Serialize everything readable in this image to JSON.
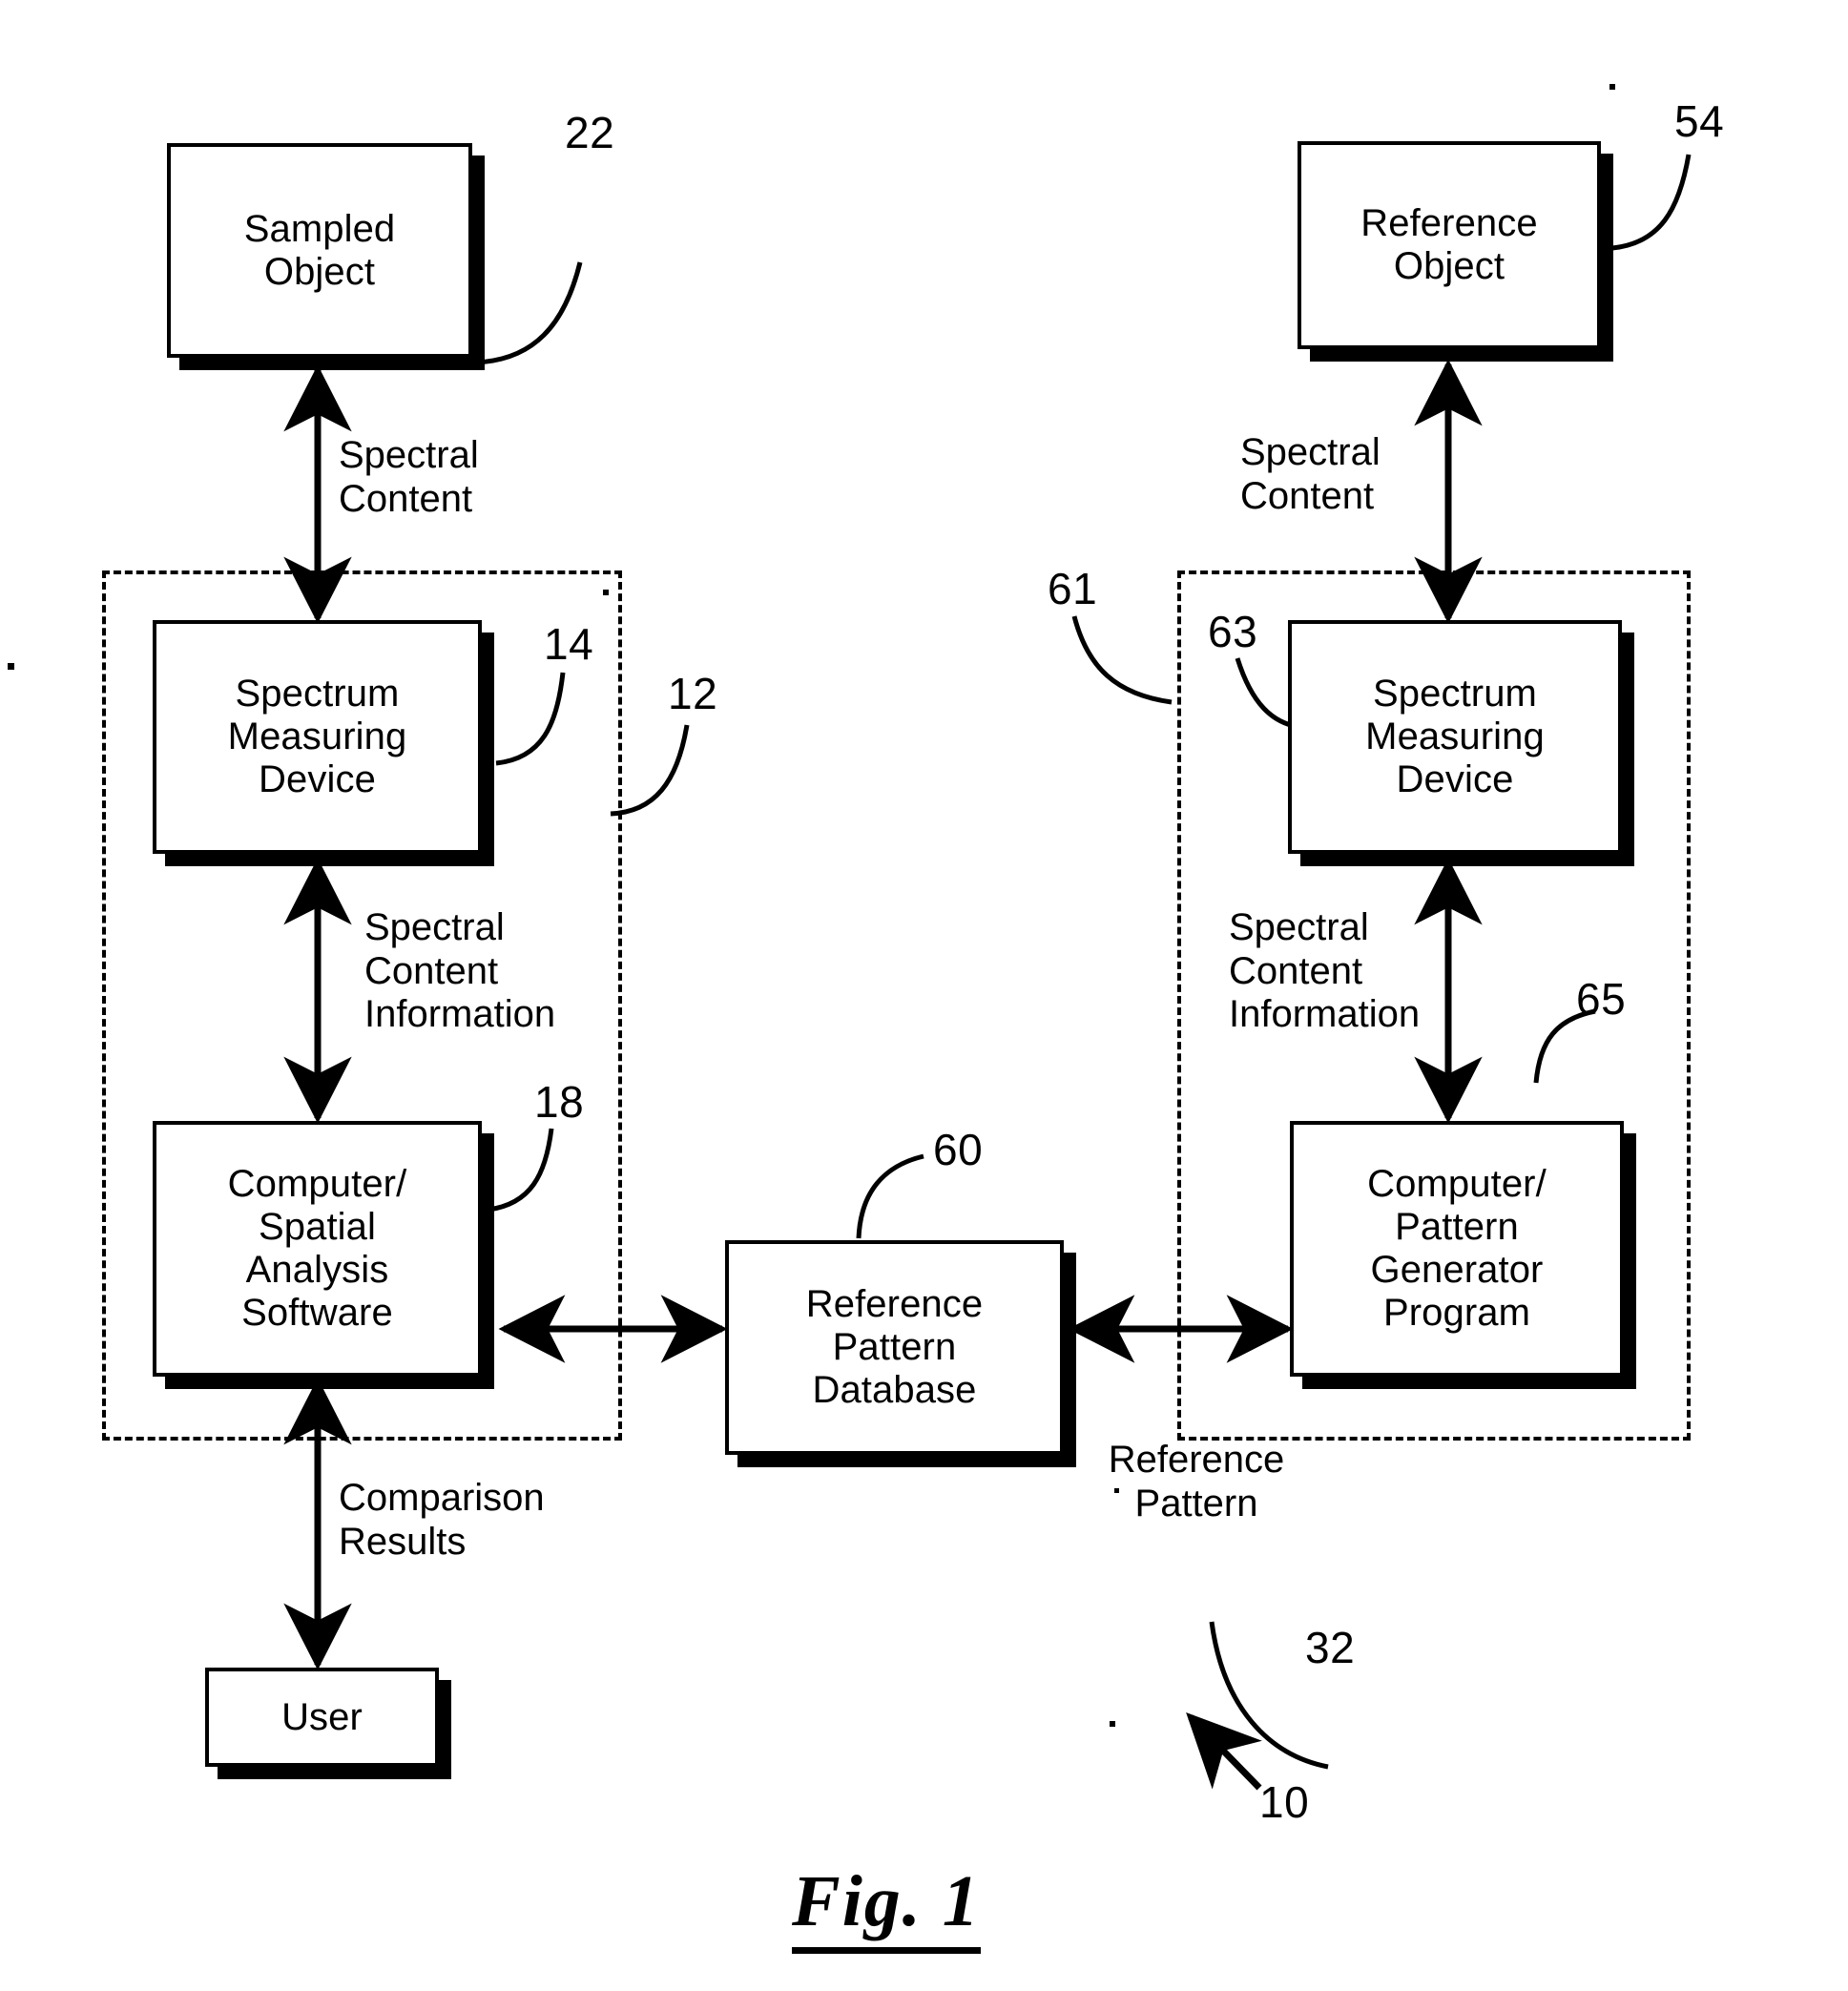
{
  "figure": {
    "caption": "Fig. 1",
    "number": "1"
  },
  "groups": [
    {
      "id": "sample-side",
      "ref": "12"
    },
    {
      "id": "reference-side",
      "ref": "61"
    }
  ],
  "nodes": {
    "sampled_object": {
      "label": "Sampled\nObject",
      "ref": "22"
    },
    "spectrum_measuring_device_left": {
      "label": "Spectrum\nMeasuring\nDevice",
      "ref": "14"
    },
    "computer_spatial_analysis_software": {
      "label": "Computer/\nSpatial\nAnalysis\nSoftware",
      "ref": "18"
    },
    "user": {
      "label": "User",
      "ref": ""
    },
    "reference_pattern_database": {
      "label": "Reference\nPattern\nDatabase",
      "ref": "60"
    },
    "reference_object": {
      "label": "Reference\nObject",
      "ref": "54"
    },
    "spectrum_measuring_device_right": {
      "label": "Spectrum\nMeasuring\nDevice",
      "ref": "63"
    },
    "computer_pattern_generator_program": {
      "label": "Computer/\nPattern\nGenerator\nProgram",
      "ref": "65"
    }
  },
  "edge_labels": {
    "spectral_content_left": "Spectral\nContent",
    "spectral_content_information_left": "Spectral\nContent\nInformation",
    "comparison_results": "Comparison\nResults",
    "spectral_content_right": "Spectral\nContent",
    "spectral_content_information_right": "Spectral\nContent\nInformation",
    "reference_pattern": "Reference\nPattern"
  },
  "reference_numerals": {
    "n10": "10",
    "n12": "12",
    "n14": "14",
    "n18": "18",
    "n22": "22",
    "n32": "32",
    "n54": "54",
    "n60": "60",
    "n61": "61",
    "n63": "63",
    "n65": "65"
  },
  "colors": {
    "ink": "#000000",
    "paper": "#ffffff"
  }
}
